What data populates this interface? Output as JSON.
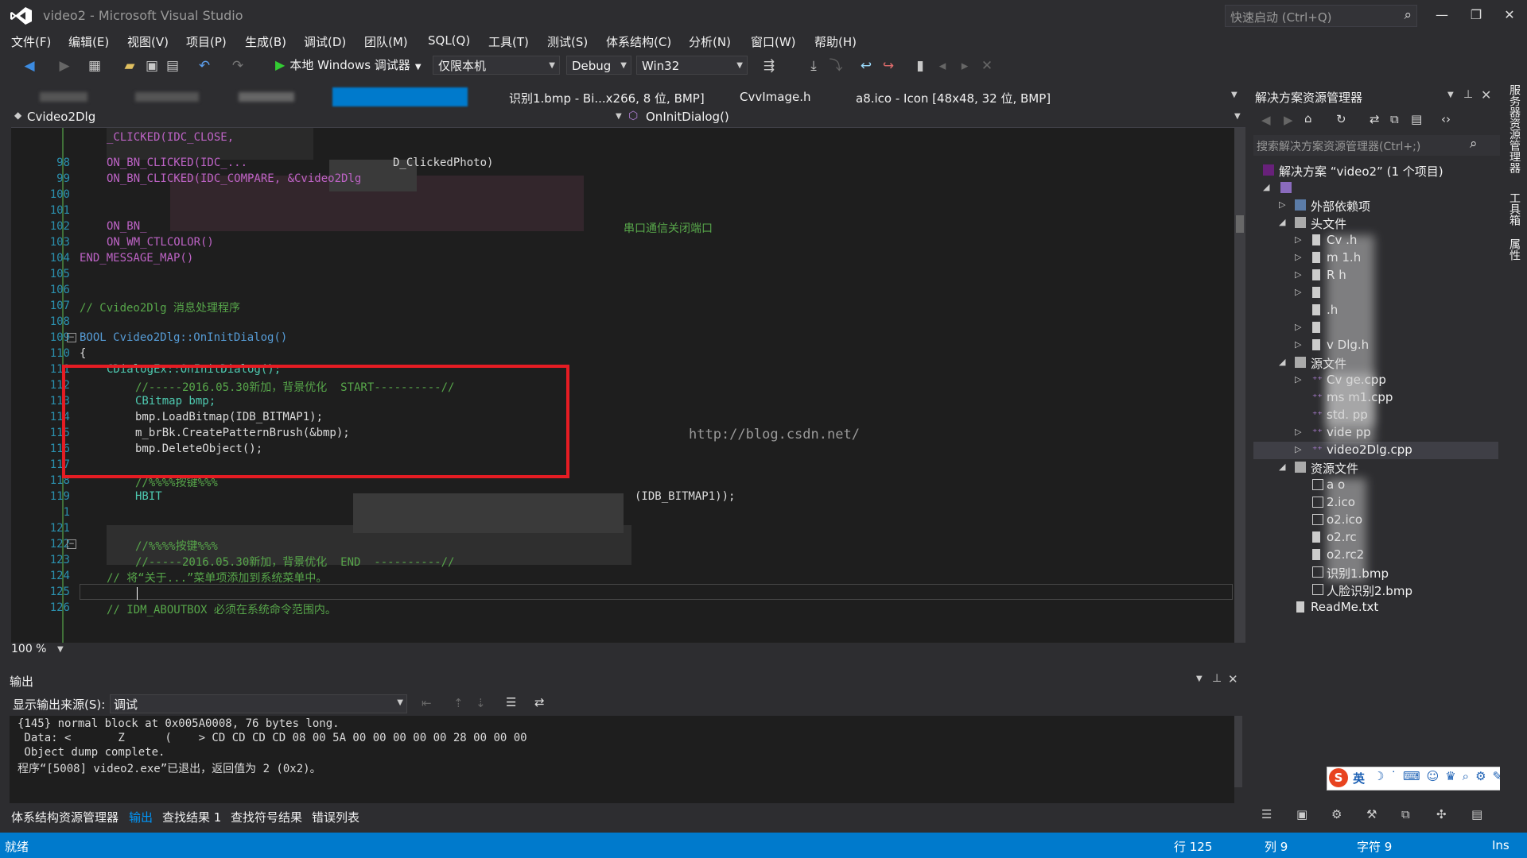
{
  "window": {
    "title": "video2 - Microsoft Visual Studio",
    "quick_launch_placeholder": "快速启动 (Ctrl+Q)"
  },
  "menu": [
    "文件(F)",
    "编辑(E)",
    "视图(V)",
    "项目(P)",
    "生成(B)",
    "调试(D)",
    "团队(M)",
    "SQL(Q)",
    "工具(T)",
    "测试(S)",
    "体系结构(C)",
    "分析(N)",
    "窗口(W)",
    "帮助(H)"
  ],
  "toolbar": {
    "run_label": "本地 Windows 调试器",
    "platform_target": "仅限本机",
    "configuration": "Debug",
    "platform": "Win32"
  },
  "doc_tabs": [
    "识别1.bmp - Bi...x266, 8 位, BMP]",
    "CvvImage.h",
    "a8.ico - Icon [48x48, 32 位, BMP]"
  ],
  "navbar": {
    "class_scope": "Cvideo2Dlg",
    "member": "OnInitDialog()"
  },
  "editor": {
    "lines": [
      {
        "n": "98",
        "code": "ON_BN_CLICKED(IDC_...",
        "tail": "D_ClickedPhoto)"
      },
      {
        "n": "99",
        "code": "ON_BN_CLICKED(IDC_COMPARE, &Cvideo2Dlg"
      },
      {
        "n": "100",
        "code": ""
      },
      {
        "n": "101",
        "code": ""
      },
      {
        "n": "102",
        "code": "ON_BN_",
        "tail": "串口通信关闭端口"
      },
      {
        "n": "103",
        "code": "ON_WM_CTLCOLOR()"
      },
      {
        "n": "104",
        "code": "END_MESSAGE_MAP()"
      },
      {
        "n": "105",
        "code": ""
      },
      {
        "n": "106",
        "code": ""
      },
      {
        "n": "107",
        "code": "// Cvideo2Dlg 消息处理程序"
      },
      {
        "n": "108",
        "code": ""
      },
      {
        "n": "109",
        "code": "BOOL Cvideo2Dlg::OnInitDialog()"
      },
      {
        "n": "110",
        "code": "{"
      },
      {
        "n": "111",
        "code": "CDialogEx::OnInitDialog();"
      },
      {
        "n": "112",
        "code": "//-----2016.05.30新加，背景优化  START----------//"
      },
      {
        "n": "113",
        "code": "CBitmap bmp;"
      },
      {
        "n": "114",
        "code": "bmp.LoadBitmap(IDB_BITMAP1);"
      },
      {
        "n": "115",
        "code": "m_brBk.CreatePatternBrush(&bmp);"
      },
      {
        "n": "116",
        "code": "bmp.DeleteObject();"
      },
      {
        "n": "117",
        "code": ""
      },
      {
        "n": "118",
        "code": "//%%%%按键%%%"
      },
      {
        "n": "119",
        "code": "HBIT",
        "tail": "(IDB_BITMAP1));"
      },
      {
        "n": "1",
        "code": ""
      },
      {
        "n": "121",
        "code": ""
      },
      {
        "n": "122",
        "code": "//%%%%按键%%%"
      },
      {
        "n": "123",
        "code": "//-----2016.05.30新加，背景优化  END  ----------//"
      },
      {
        "n": "124",
        "code": "// 将“关于...”菜单项添加到系统菜单中。"
      },
      {
        "n": "125",
        "code": ""
      },
      {
        "n": "126",
        "code": "// IDM_ABOUTBOX 必须在系统命令范围内。"
      }
    ],
    "partial_top_code": "_CLICKED(IDC_CLOSE,",
    "watermark": "http://blog.csdn.net/",
    "zoom": "100 %"
  },
  "output": {
    "title": "输出",
    "source_label": "显示输出来源(S):",
    "source_value": "调试",
    "lines": [
      "{145} normal block at 0x005A0008, 76 bytes long.",
      " Data: <       Z      (    > CD CD CD CD 08 00 5A 00 00 00 00 00 28 00 00 00",
      " Object dump complete.",
      "程序“[5008] video2.exe”已退出，返回值为 2 (0x2)。"
    ]
  },
  "bottom_tabs": [
    "体系结构资源管理器",
    "输出",
    "查找结果 1",
    "查找符号结果",
    "错误列表"
  ],
  "status": {
    "left": "就绪",
    "row": "行 125",
    "col": "列 9",
    "char": "字符 9",
    "mode": "Ins"
  },
  "solution_explorer": {
    "title": "解决方案资源管理器",
    "search_placeholder": "搜索解决方案资源管理器(Ctrl+;)",
    "solution": "解决方案 “video2” (1 个项目)",
    "items": [
      {
        "label": "外部依赖项"
      },
      {
        "label": "头文件"
      },
      {
        "label": "Cv        .h"
      },
      {
        "label": "m         1.h"
      },
      {
        "label": "R         h"
      },
      {
        "label": "          "
      },
      {
        "label": "          .h"
      },
      {
        "label": "          "
      },
      {
        "label": "v        Dlg.h"
      },
      {
        "label": "源文件"
      },
      {
        "label": "Cv       ge.cpp"
      },
      {
        "label": "ms       m1.cpp"
      },
      {
        "label": "std.     pp"
      },
      {
        "label": "vide     pp"
      },
      {
        "label": "video2Dlg.cpp"
      },
      {
        "label": "资源文件"
      },
      {
        "label": "a      o"
      },
      {
        "label": "       2.ico"
      },
      {
        "label": "      o2.ico"
      },
      {
        "label": "      o2.rc"
      },
      {
        "label": "      o2.rc2"
      },
      {
        "label": "   识别1.bmp"
      },
      {
        "label": "人脸识别2.bmp"
      },
      {
        "label": "ReadMe.txt"
      }
    ]
  },
  "side_tabs": [
    "服务器资源管理器",
    "工具箱",
    "属性"
  ],
  "ime": "英"
}
